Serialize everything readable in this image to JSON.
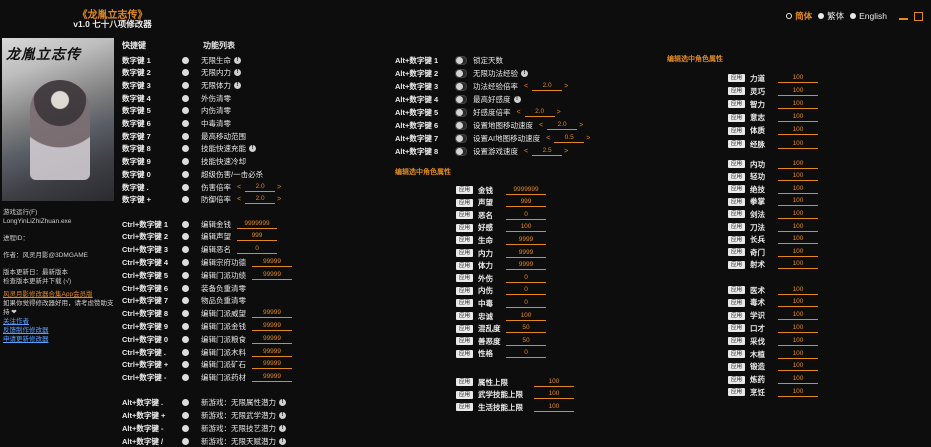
{
  "header": {
    "title": "《龙胤立志传》",
    "subtitle": "v1.0 七十八项修改器"
  },
  "lang": {
    "options": [
      "简体",
      "繁体",
      "English"
    ],
    "selected": "简体"
  },
  "cover": {
    "title": "龙胤立志传"
  },
  "sidebar_info": {
    "author_label": "游戏运行(F)",
    "author_url": "LongYinLiZhiZhuan.exe",
    "process_label": "进程ID：",
    "publisher": "作者：风灵月影@3DMGAME",
    "version_lines": [
      "版本更新日：最新版本",
      "检查版本更新并下载 (√)"
    ],
    "warn": "风灵月影修改器合集App会员版",
    "support": "如果你觉得修改器好用，请考虑赞助支持 ❤",
    "links": [
      "关注作者",
      "反馈制作修改器",
      "申请更新修改器"
    ]
  },
  "col1": {
    "hotkey_header": "快捷键",
    "func_header": "功能列表",
    "rows": [
      {
        "key": "数字键 1",
        "label": "无限生命",
        "info": true
      },
      {
        "key": "数字键 2",
        "label": "无限内力",
        "info": true
      },
      {
        "key": "数字键 3",
        "label": "无限体力",
        "info": true
      },
      {
        "key": "数字键 4",
        "label": "外伤清零"
      },
      {
        "key": "数字键 5",
        "label": "内伤清零"
      },
      {
        "key": "数字键 6",
        "label": "中毒清零"
      },
      {
        "key": "数字键 7",
        "label": "最高移动范围"
      },
      {
        "key": "数字键 8",
        "label": "技能快速充能",
        "info": true
      },
      {
        "key": "数字键 9",
        "label": "技能快速冷却"
      },
      {
        "key": "数字键 0",
        "label": "超级伤害/一击必杀"
      },
      {
        "key": "数字键 .",
        "label": "伤害倍率",
        "value": "2.0"
      },
      {
        "key": "数字键 +",
        "label": "防御倍率",
        "value": "2.0"
      }
    ],
    "rows2": [
      {
        "key": "Ctrl+数字键 1",
        "label": "编辑金钱",
        "value": "9999999"
      },
      {
        "key": "Ctrl+数字键 2",
        "label": "编辑声望",
        "value": "999"
      },
      {
        "key": "Ctrl+数字键 3",
        "label": "编辑恶名",
        "value": "0"
      },
      {
        "key": "Ctrl+数字键 4",
        "label": "编辑宗府功德",
        "value": "99999"
      },
      {
        "key": "Ctrl+数字键 5",
        "label": "编辑门派功绩",
        "value": "99999"
      },
      {
        "key": "Ctrl+数字键 6",
        "label": "装备负重清零"
      },
      {
        "key": "Ctrl+数字键 7",
        "label": "物品负重清零"
      },
      {
        "key": "Ctrl+数字键 8",
        "label": "编辑门派威望",
        "value": "99999"
      },
      {
        "key": "Ctrl+数字键 9",
        "label": "编辑门派金钱",
        "value": "99999"
      },
      {
        "key": "Ctrl+数字键 0",
        "label": "编辑门派粮食",
        "value": "99999"
      },
      {
        "key": "Ctrl+数字键 .",
        "label": "编辑门派木料",
        "value": "99999"
      },
      {
        "key": "Ctrl+数字键 +",
        "label": "编辑门派矿石",
        "value": "99999"
      },
      {
        "key": "Ctrl+数字键 -",
        "label": "编辑门派药材",
        "value": "99999"
      }
    ],
    "rows3": [
      {
        "key": "Alt+数字键 .",
        "label": "新游戏：无限属性潜力",
        "info": true
      },
      {
        "key": "Alt+数字键 +",
        "label": "新游戏：无限武学潜力",
        "info": true
      },
      {
        "key": "Alt+数字键 -",
        "label": "新游戏：无限技艺潜力",
        "info": true
      },
      {
        "key": "Alt+数字键 /",
        "label": "新游戏：无限天赋潜力",
        "info": true
      }
    ]
  },
  "col2": {
    "rows": [
      {
        "key": "Alt+数字键 1",
        "label": "锁定天数"
      },
      {
        "key": "Alt+数字键 2",
        "label": "无限功法经验",
        "info": true
      },
      {
        "key": "Alt+数字键 3",
        "label": "功法经验倍率",
        "value": "2.0"
      },
      {
        "key": "Alt+数字键 4",
        "label": "最高好感度",
        "info": true
      },
      {
        "key": "Alt+数字键 5",
        "label": "好感度倍率",
        "value": "2.0"
      },
      {
        "key": "Alt+数字键 6",
        "label": "设置地图移动速度",
        "value": "2.0"
      },
      {
        "key": "Alt+数字键 7",
        "label": "设置AI地图移动速度",
        "value": "0.5"
      },
      {
        "key": "Alt+数字键 8",
        "label": "设置游戏速度",
        "value": "2.5"
      }
    ],
    "edit_header": "编辑选中角色属性",
    "apply": "应用",
    "props": [
      {
        "label": "金钱",
        "value": "9999999"
      },
      {
        "label": "声望",
        "value": "999"
      },
      {
        "label": "恶名",
        "value": "0"
      },
      {
        "label": "好感",
        "value": "100"
      },
      {
        "label": "生命",
        "value": "9999"
      },
      {
        "label": "内力",
        "value": "9999"
      },
      {
        "label": "体力",
        "value": "9999"
      },
      {
        "label": "外伤",
        "value": "0"
      },
      {
        "label": "内伤",
        "value": "0"
      },
      {
        "label": "中毒",
        "value": "0"
      },
      {
        "label": "忠诚",
        "value": "100"
      },
      {
        "label": "混乱度",
        "value": "50"
      },
      {
        "label": "善恶度",
        "value": "50"
      },
      {
        "label": "性格",
        "value": "0"
      }
    ],
    "props2": [
      {
        "label": "属性上限",
        "value": "100"
      },
      {
        "label": "武学技能上限",
        "value": "100"
      },
      {
        "label": "生活技能上限",
        "value": "100"
      }
    ]
  },
  "col3": {
    "edit_header": "编辑选中角色属性",
    "apply": "应用",
    "group1": [
      {
        "label": "力道",
        "value": "100"
      },
      {
        "label": "灵巧",
        "value": "100"
      },
      {
        "label": "智力",
        "value": "100"
      },
      {
        "label": "意志",
        "value": "100"
      },
      {
        "label": "体质",
        "value": "100"
      },
      {
        "label": "经脉",
        "value": "100"
      }
    ],
    "group2": [
      {
        "label": "内功",
        "value": "100"
      },
      {
        "label": "轻功",
        "value": "100"
      },
      {
        "label": "绝技",
        "value": "100"
      },
      {
        "label": "拳掌",
        "value": "100"
      },
      {
        "label": "剑法",
        "value": "100"
      },
      {
        "label": "刀法",
        "value": "100"
      },
      {
        "label": "长兵",
        "value": "100"
      },
      {
        "label": "奇门",
        "value": "100"
      },
      {
        "label": "射术",
        "value": "100"
      }
    ],
    "group3": [
      {
        "label": "医术",
        "value": "100"
      },
      {
        "label": "毒术",
        "value": "100"
      },
      {
        "label": "学识",
        "value": "100"
      },
      {
        "label": "口才",
        "value": "100"
      },
      {
        "label": "采伐",
        "value": "100"
      },
      {
        "label": "木植",
        "value": "100"
      },
      {
        "label": "锻造",
        "value": "100"
      },
      {
        "label": "炼药",
        "value": "100"
      },
      {
        "label": "烹饪",
        "value": "100"
      }
    ]
  }
}
